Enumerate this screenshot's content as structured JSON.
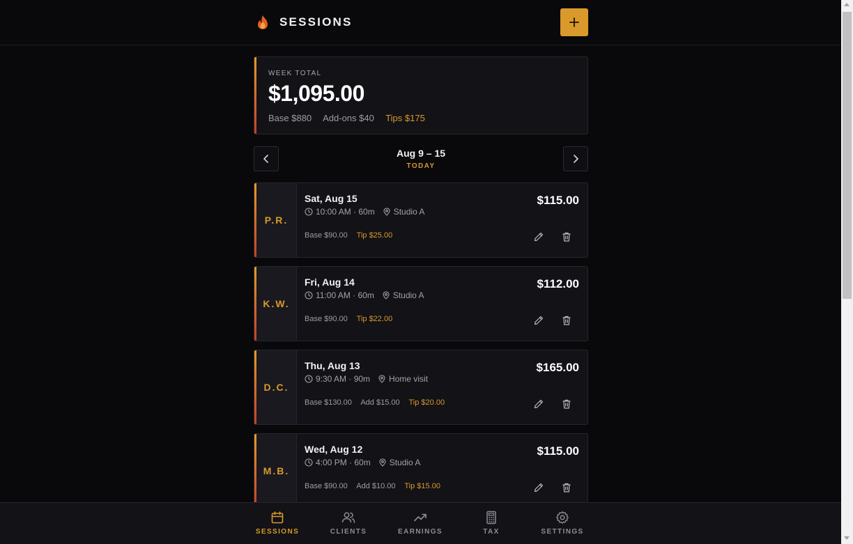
{
  "header": {
    "title": "SESSIONS",
    "add_label": "+"
  },
  "week": {
    "label": "WEEK TOTAL",
    "total": "$1,095.00",
    "base": "Base $880",
    "addons": "Add-ons $40",
    "tips": "Tips $175",
    "range": "Aug 9 – 15",
    "today": "TODAY"
  },
  "sessions": [
    {
      "initials": "P.R.",
      "date": "Sat, Aug 15",
      "time": "10:00 AM · 60m",
      "location": "Studio A",
      "amount": "$115.00",
      "base": "Base $90.00",
      "add": "",
      "tip": "Tip $25.00"
    },
    {
      "initials": "K.W.",
      "date": "Fri, Aug 14",
      "time": "11:00 AM · 60m",
      "location": "Studio A",
      "amount": "$112.00",
      "base": "Base $90.00",
      "add": "",
      "tip": "Tip $22.00"
    },
    {
      "initials": "D.C.",
      "date": "Thu, Aug 13",
      "time": "9:30 AM · 90m",
      "location": "Home visit",
      "amount": "$165.00",
      "base": "Base $130.00",
      "add": "Add $15.00",
      "tip": "Tip $20.00"
    },
    {
      "initials": "M.B.",
      "date": "Wed, Aug 12",
      "time": "4:00 PM · 60m",
      "location": "Studio A",
      "amount": "$115.00",
      "base": "Base $90.00",
      "add": "Add $10.00",
      "tip": "Tip $15.00"
    }
  ],
  "nav": [
    {
      "label": "SESSIONS",
      "icon": "calendar-icon",
      "active": true
    },
    {
      "label": "CLIENTS",
      "icon": "users-icon",
      "active": false
    },
    {
      "label": "EARNINGS",
      "icon": "trending-up-icon",
      "active": false
    },
    {
      "label": "TAX",
      "icon": "calculator-icon",
      "active": false
    },
    {
      "label": "SETTINGS",
      "icon": "gear-icon",
      "active": false
    }
  ],
  "colors": {
    "accent": "#d99a2b",
    "background": "#09090c",
    "card": "#121217"
  }
}
